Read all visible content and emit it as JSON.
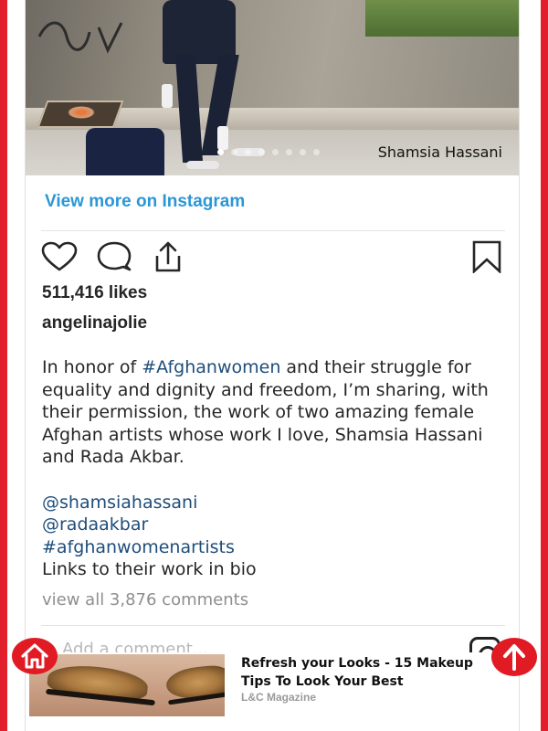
{
  "post": {
    "image_credit": "Shamsia Hassani",
    "carousel": {
      "total": 8,
      "active": 0
    },
    "view_more_label": "View more on Instagram",
    "likes": "511,416 likes",
    "username": "angelinajolie",
    "caption": {
      "line1_prefix": "In honor of ",
      "line1_tag": "#Afghanwomen",
      "line1_rest": " and their struggle for equality and dignity and freedom, I’m sharing, with their permission, the work of two amazing female Afghan artists whose work I love, Shamsia Hassani and Rada Akbar.",
      "mention1": "@shamsiahassani",
      "mention2": "@radaakbar",
      "hashtag": "#afghanwomenartists",
      "links_note": "Links to their work in bio"
    },
    "view_comments": "view all 3,876 comments",
    "add_comment_placeholder": "Add a comment..."
  },
  "ad": {
    "title": "Refresh your Looks - 15 Makeup Tips To Look Your Best",
    "source": "L&C Magazine"
  },
  "colors": {
    "frame": "#e2202d",
    "link": "#2b97d6",
    "hashtag": "#1e4d7a",
    "float_button": "#e01b24"
  },
  "icons": {
    "like": "heart-icon",
    "comment": "comment-bubble-icon",
    "share": "share-upload-icon",
    "save": "bookmark-icon",
    "instagram": "instagram-icon",
    "home": "home-icon",
    "scroll_top": "arrow-up-icon"
  }
}
